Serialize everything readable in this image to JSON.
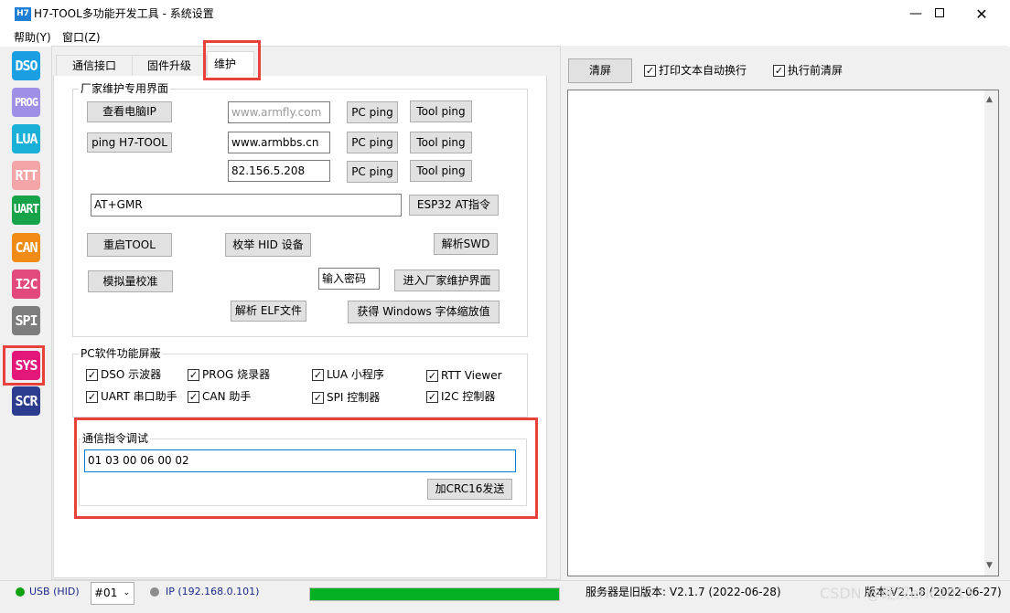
{
  "window": {
    "app_icon_text": "H7",
    "title": "H7-TOOL多功能开发工具 - 系统设置"
  },
  "menu": {
    "help": "帮助(Y)",
    "window": "窗口(Z)"
  },
  "toolbar": [
    {
      "label": "DSO",
      "color": "#1a9fe3"
    },
    {
      "label": "PROG",
      "color": "#9f8fe6"
    },
    {
      "label": "LUA",
      "color": "#1bb0d8"
    },
    {
      "label": "RTT",
      "color": "#f4a5a8"
    },
    {
      "label": "UART",
      "color": "#17a34a"
    },
    {
      "label": "CAN",
      "color": "#f08c15"
    },
    {
      "label": "I2C",
      "color": "#e24a7d"
    },
    {
      "label": "SPI",
      "color": "#7d7d7d"
    },
    {
      "label": "SYS",
      "color": "#e3167a"
    },
    {
      "label": "SCR",
      "color": "#2c3d8f"
    }
  ],
  "tabs": {
    "comm": "通信接口",
    "firmware": "固件升级",
    "maintain": "维护"
  },
  "factory": {
    "legend": "厂家维护专用界面",
    "view_ip": "查看电脑IP",
    "ping_tool": "ping H7-TOOL",
    "host1": "www.armfly.com",
    "host2": "www.armbbs.cn",
    "host3": "82.156.5.208",
    "pc_ping": "PC ping",
    "tool_ping": "Tool ping",
    "at_cmd": "AT+GMR",
    "esp32_btn": "ESP32 AT指令",
    "restart": "重启TOOL",
    "enum_hid": "枚举 HID 设备",
    "parse_swd": "解析SWD",
    "analog_cal": "模拟量校准",
    "password_placeholder": "输入密码",
    "enter_factory": "进入厂家维护界面",
    "parse_elf": "解析 ELF文件",
    "win_scale": "获得 Windows 字体缩放值"
  },
  "pc_shield": {
    "legend": "PC软件功能屏蔽",
    "items": [
      {
        "label": "DSO 示波器",
        "checked": true
      },
      {
        "label": "PROG 烧录器",
        "checked": true
      },
      {
        "label": "LUA 小程序",
        "checked": true
      },
      {
        "label": "RTT Viewer",
        "checked": true
      },
      {
        "label": "UART 串口助手",
        "checked": true
      },
      {
        "label": "CAN 助手",
        "checked": true
      },
      {
        "label": "SPI 控制器",
        "checked": true
      },
      {
        "label": "I2C 控制器",
        "checked": true
      }
    ]
  },
  "debug": {
    "legend": "通信指令调试",
    "command": "01 03 00 06 00 02",
    "send_crc": "加CRC16发送"
  },
  "log_panel": {
    "clear": "清屏",
    "auto_wrap": "打印文本自动换行",
    "clear_before": "执行前清屏"
  },
  "status": {
    "usb": "USB (HID)",
    "device": "#01",
    "ip": "IP (192.168.0.101)",
    "progress": 1.0,
    "server_version": "服务器是旧版本: V2.1.7 (2022-06-28)",
    "local_version": "版本:V2.1.8 (2022-06-27)",
    "watermark": "CSDN @硬汉eric2013"
  }
}
